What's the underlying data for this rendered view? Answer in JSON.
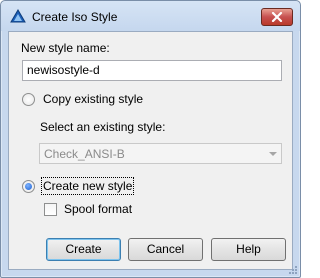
{
  "window": {
    "title": "Create Iso Style"
  },
  "form": {
    "name_label": "New style name:",
    "name_value": "newisostyle-d",
    "copy_option_label": "Copy existing style",
    "select_label": "Select an existing style:",
    "select_value": "Check_ANSI-B",
    "create_option_label": "Create new style",
    "create_option_selected": true,
    "spool_label": "Spool format",
    "spool_checked": false
  },
  "buttons": {
    "create": "Create",
    "cancel": "Cancel",
    "help": "Help"
  },
  "icons": {
    "app": "iso-style-icon",
    "close": "close-icon",
    "dropdown": "chevron-down-icon"
  },
  "colors": {
    "close_button": "#c75050",
    "title_bar": "#c5d7ee",
    "client_bg": "#f0f0f0",
    "radio_dot": "#1c5fcf"
  }
}
